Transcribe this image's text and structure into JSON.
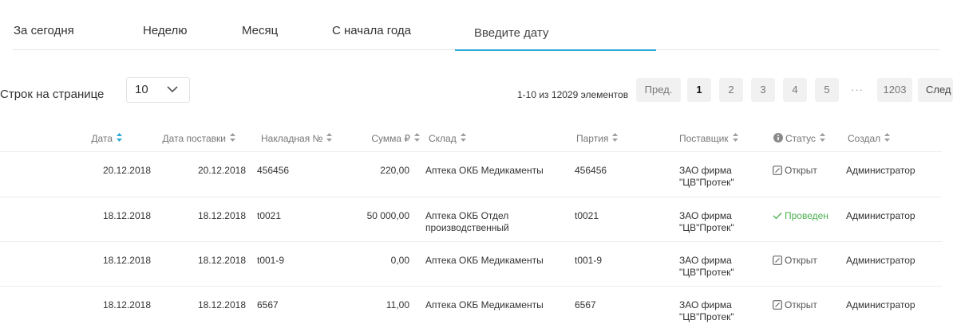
{
  "tabs": [
    {
      "label": "За сегодня"
    },
    {
      "label": "Неделю"
    },
    {
      "label": "Месяц"
    },
    {
      "label": "С начала года"
    },
    {
      "label": "Введите дату",
      "active": true
    }
  ],
  "rows_per_page": {
    "label": "Строк на странице",
    "value": "10",
    "icon": "chevron-down-icon"
  },
  "pagination": {
    "info": "1-10 из 12029 элементов",
    "prev": "Пред.",
    "pages": [
      "1",
      "2",
      "3",
      "4",
      "5"
    ],
    "current": "1",
    "ellipsis": "···",
    "last": "1203",
    "next": "След"
  },
  "table": {
    "columns": [
      "Дата",
      "Дата поставки",
      "Накладная №",
      "Сумма ₽",
      "Склад",
      "Партия",
      "Поставщик",
      "Статус",
      "Создал"
    ],
    "rows": [
      {
        "date": "20.12.2018",
        "delivery_date": "20.12.2018",
        "invoice": "456456",
        "sum": "220,00",
        "warehouse": "Аптека ОКБ Медикаменты",
        "batch": "456456",
        "supplier": "ЗАО фирма \"ЦВ\"Протек\"",
        "status": "Открыт",
        "status_icon": "edit-icon",
        "created_by": "Администратор"
      },
      {
        "date": "18.12.2018",
        "delivery_date": "18.12.2018",
        "invoice": "t0021",
        "sum": "50 000,00",
        "warehouse": "Аптека ОКБ Отдел производственный",
        "batch": "t0021",
        "supplier": "ЗАО фирма \"ЦВ\"Протек\"",
        "status": "Проведен",
        "status_icon": "check-icon",
        "created_by": "Администратор"
      },
      {
        "date": "18.12.2018",
        "delivery_date": "18.12.2018",
        "invoice": "t001-9",
        "sum": "0,00",
        "warehouse": "Аптека ОКБ Медикаменты",
        "batch": "t001-9",
        "supplier": "ЗАО фирма \"ЦВ\"Протек\"",
        "status": "Открыт",
        "status_icon": "edit-icon",
        "created_by": "Администратор"
      },
      {
        "date": "18.12.2018",
        "delivery_date": "18.12.2018",
        "invoice": "6567",
        "sum": "11,00",
        "warehouse": "Аптека ОКБ Медикаменты",
        "batch": "6567",
        "supplier": "ЗАО фирма \"ЦВ\"Протек\"",
        "status": "Открыт",
        "status_icon": "edit-icon",
        "created_by": "Администратор"
      }
    ]
  },
  "colors": {
    "accent": "#2aa8d8",
    "status_done": "#4caf50",
    "sort_active": "#2aa8d8",
    "sort_inactive": "#9e9e9e"
  }
}
